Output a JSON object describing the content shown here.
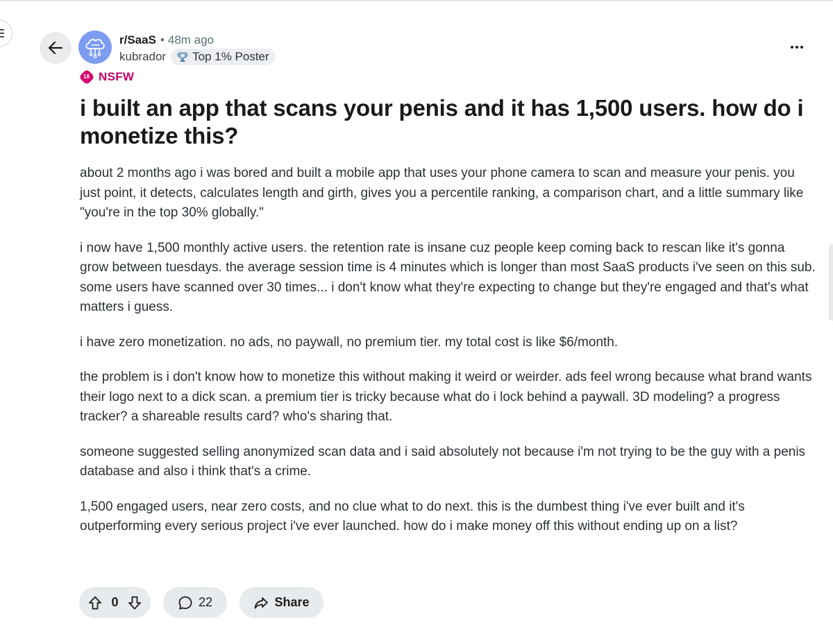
{
  "post": {
    "subreddit": "r/SaaS",
    "separator": "•",
    "time_ago": "48m ago",
    "author": "kubrador",
    "flair": "Top 1% Poster",
    "nsfw_badge": "18",
    "nsfw_label": "NSFW",
    "title": "i built an app that scans your penis and it has 1,500 users. how do i monetize this?",
    "paragraphs": [
      "about 2 months ago i was bored and built a mobile app that uses your phone camera to scan and measure your penis. you just point, it detects, calculates length and girth, gives you a percentile ranking, a comparison chart, and a little summary like \"you're in the top 30% globally.\"",
      "i now have 1,500 monthly active users. the retention rate is insane cuz people keep coming back to rescan like it's gonna grow between tuesdays. the average session time is 4 minutes which is longer than most SaaS products i've seen on this sub. some users have scanned over 30 times... i don't know what they're expecting to change but they're engaged and that's what matters i guess.",
      "i have zero monetization. no ads, no paywall, no premium tier. my total cost is like $6/month.",
      "the problem is i don't know how to monetize this without making it weird or weirder. ads feel wrong because what brand wants their logo next to a dick scan. a premium tier is tricky because what do i lock behind a paywall. 3D modeling? a progress tracker? a shareable results card? who's sharing that.",
      "someone suggested selling anonymized scan data and i said absolutely not because i'm not trying to be the guy with a penis database and also i think that's a crime.",
      "1,500 engaged users, near zero costs, and no clue what to do next. this is the dumbest thing i've ever built and it's outperforming every serious project i've ever launched. how do i make money off this without ending up on a list?"
    ]
  },
  "actions": {
    "vote_count": "0",
    "comment_count": "22",
    "share_label": "Share"
  },
  "icons": {
    "back": "arrow-left-icon",
    "avatar": "cloud-network-icon",
    "flair": "trophy-icon",
    "more": "more-horizontal-icon",
    "upvote": "arrow-up-icon",
    "downvote": "arrow-down-icon",
    "comment": "speech-bubble-icon",
    "share": "share-arrow-icon"
  },
  "colors": {
    "accent_nsfw": "#c3006a",
    "avatar_bg": "#7b9cf0",
    "pill_bg": "#e8ebed"
  }
}
